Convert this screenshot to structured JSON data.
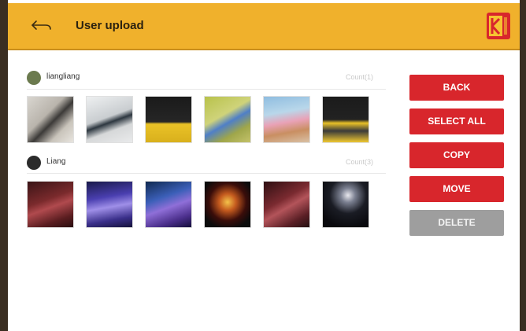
{
  "header": {
    "title": "User upload",
    "back_icon": "back-arrow-icon",
    "logo": "kodak-logo"
  },
  "groups": [
    {
      "user": "liangliang",
      "count": "Count(1)",
      "photos": [
        "photo-1",
        "photo-2",
        "photo-3",
        "photo-4",
        "photo-5",
        "photo-6"
      ]
    },
    {
      "user": "Liang",
      "count": "Count(3)",
      "photos": [
        "photo-7",
        "photo-8",
        "photo-9",
        "photo-10",
        "photo-11",
        "photo-12"
      ]
    }
  ],
  "actions": {
    "back": "BACK",
    "select_all": "SELECT ALL",
    "copy": "COPY",
    "move": "MOVE",
    "delete": "DELETE"
  },
  "colors": {
    "header": "#f0b12c",
    "accent": "#d8262c",
    "disabled": "#9e9e9e"
  }
}
